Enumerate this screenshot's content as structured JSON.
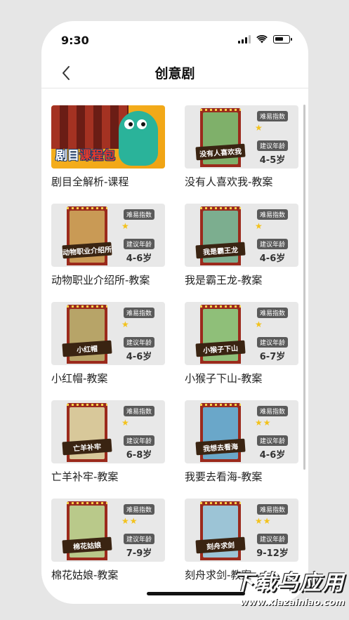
{
  "status": {
    "time": "9:30"
  },
  "nav": {
    "title": "创意剧"
  },
  "labels": {
    "difficulty": "难易指数",
    "age": "建议年龄"
  },
  "banner": {
    "text_a": "剧目",
    "text_b": "课程包",
    "title": "剧目全解析-课程"
  },
  "items": [
    {
      "title": "没有人喜欢我-教案",
      "poster": "没有人喜欢我",
      "stars": "★",
      "age": "4-5岁",
      "scene": "#7fb06a"
    },
    {
      "title": "动物职业介绍所-教案",
      "poster": "动物职业介绍所",
      "stars": "★",
      "age": "4-6岁",
      "scene": "#c99a55"
    },
    {
      "title": "我是霸王龙-教案",
      "poster": "我是霸王龙",
      "stars": "★",
      "age": "4-6岁",
      "scene": "#7cae8f"
    },
    {
      "title": "小红帽-教案",
      "poster": "小红帽",
      "stars": "★",
      "age": "4-6岁",
      "scene": "#b7a468"
    },
    {
      "title": "小猴子下山-教案",
      "poster": "小猴子下山",
      "stars": "★",
      "age": "6-7岁",
      "scene": "#8fbf79"
    },
    {
      "title": "亡羊补牢-教案",
      "poster": "亡羊补牢",
      "stars": "★",
      "age": "6-8岁",
      "scene": "#d8c89a"
    },
    {
      "title": "我要去看海-教案",
      "poster": "我想去看海",
      "stars": "★★",
      "age": "4-6岁",
      "scene": "#6aa7c9"
    },
    {
      "title": "棉花姑娘-教案",
      "poster": "棉花姑娘",
      "stars": "★★",
      "age": "7-9岁",
      "scene": "#b9c98a"
    },
    {
      "title": "刻舟求剑-教案",
      "poster": "刻舟求剑",
      "stars": "★★",
      "age": "9-12岁",
      "scene": "#9cc4d6"
    }
  ],
  "watermark": {
    "big": "下载鸟应用",
    "small": "www.xiazainiao.com"
  },
  "colors": {
    "star": "#f3c21b",
    "tag": "#5a5a5a",
    "accent": "#9b2a1c"
  }
}
